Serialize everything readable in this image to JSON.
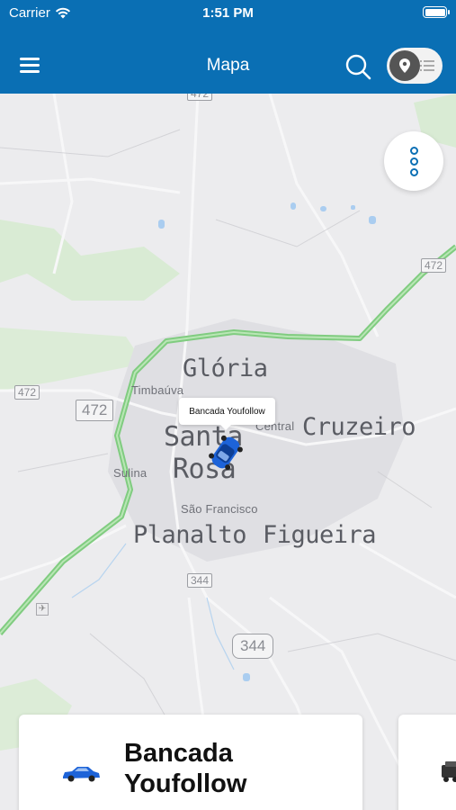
{
  "status_bar": {
    "carrier": "Carrier",
    "time": "1:51 PM"
  },
  "header": {
    "title": "Mapa",
    "menu_icon": "hamburger-menu-icon",
    "search_icon": "search-icon",
    "toggle": {
      "selected": "map",
      "icons": [
        "map-pin-icon",
        "list-icon"
      ]
    }
  },
  "map": {
    "labels": {
      "gloria": "Glória",
      "timbauva": "Timbaúva",
      "santa_rosa_1": "Santa",
      "santa_rosa_2": "Rosa",
      "central": "Central",
      "cruzeiro": "Cruzeiro",
      "sulina": "Sulina",
      "sao_francisco": "São Francisco",
      "planalto": "Planalto",
      "figueira": "Figueira"
    },
    "shields": {
      "r472_top": "472",
      "r472_left": "472",
      "r472_mid": "472",
      "r344_small": "344",
      "r344_big": "344"
    },
    "popup": "Bancada Youfollow",
    "colors": {
      "highway": "#8fd58f",
      "water": "#a9cdf0",
      "park": "#cfe8c9",
      "urban": "#dedee2"
    }
  },
  "vehicles": [
    {
      "name": "Bancada Youfollow",
      "icon": "blue-car-icon"
    },
    {
      "name": "",
      "icon": "truck-icon"
    }
  ],
  "theme": {
    "primary": "#0a6fb4"
  }
}
